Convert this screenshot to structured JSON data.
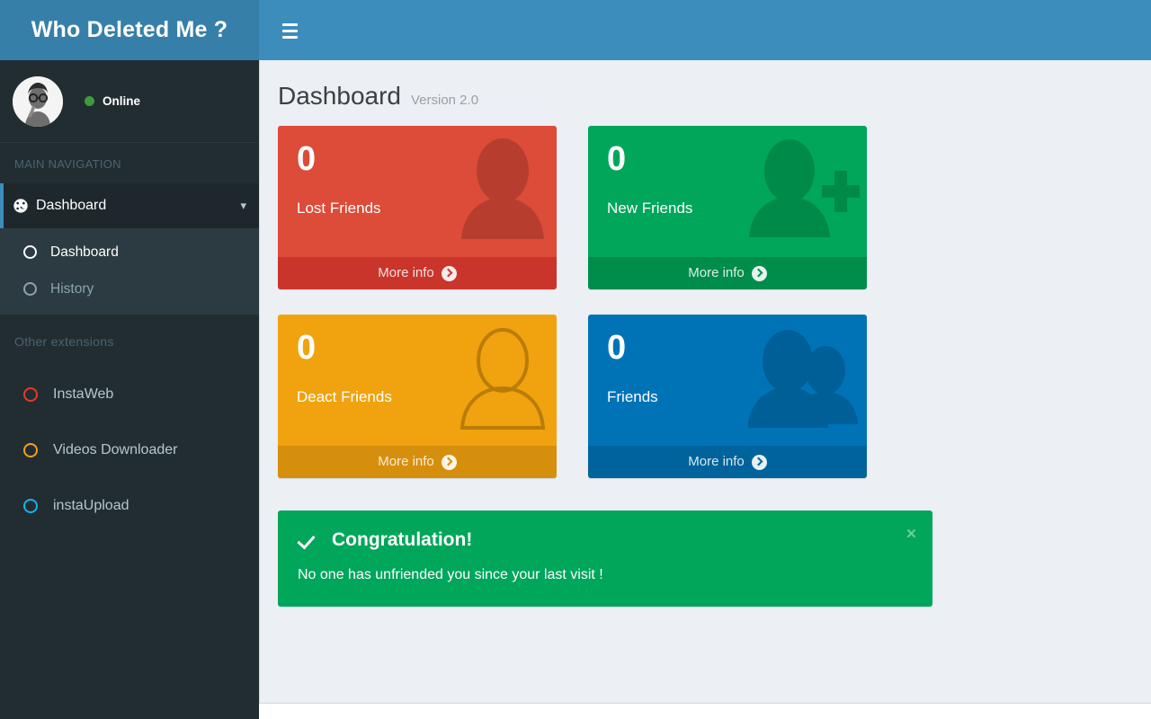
{
  "app": {
    "logo": "Who Deleted Me ?"
  },
  "navbar": {
    "menu_toggle_icon": "hamburger-icon"
  },
  "sidebar": {
    "user": {
      "status": "Online",
      "avatar_icon": "user-avatar-photo",
      "status_dot_color": "#3c9c3c"
    },
    "main_nav_header": "MAIN NAVIGATION",
    "nav": {
      "dashboard": {
        "label": "Dashboard",
        "icon": "dashboard-icon",
        "chevron": "chevron-down-icon"
      },
      "submenu": [
        {
          "label": "Dashboard",
          "icon": "circle-o-icon",
          "active": true
        },
        {
          "label": "History",
          "icon": "circle-o-icon",
          "active": false
        }
      ]
    },
    "other_header": "Other extensions",
    "extensions": [
      {
        "label": "InstaWeb",
        "icon": "circle-o-icon",
        "color": "#e8392b"
      },
      {
        "label": "Videos Downloader",
        "icon": "circle-o-icon",
        "color": "#f5a01a"
      },
      {
        "label": "instaUpload",
        "icon": "circle-o-icon",
        "color": "#16b4e8"
      }
    ]
  },
  "page": {
    "title": "Dashboard",
    "version": "Version 2.0"
  },
  "cards": [
    {
      "value": "0",
      "label": "Lost Friends",
      "more": "More info",
      "art": "user-icon",
      "bg": "#dd4b39",
      "foot_bg": "#c9352b"
    },
    {
      "value": "0",
      "label": "New Friends",
      "more": "More info",
      "art": "user-plus-icon",
      "bg": "#00a65a",
      "foot_bg": "#008d4c"
    },
    {
      "value": "0",
      "label": "Deact Friends",
      "more": "More info",
      "art": "user-outline-icon",
      "bg": "#f0a30f",
      "foot_bg": "#d68f0c"
    },
    {
      "value": "0",
      "label": "Friends",
      "more": "More info",
      "art": "users-icon",
      "bg": "#0073b7",
      "foot_bg": "#00639b"
    }
  ],
  "alert": {
    "icon": "check-icon",
    "title": "Congratulation!",
    "message": "No one has unfriended you since your last visit !",
    "close_label": "×"
  }
}
